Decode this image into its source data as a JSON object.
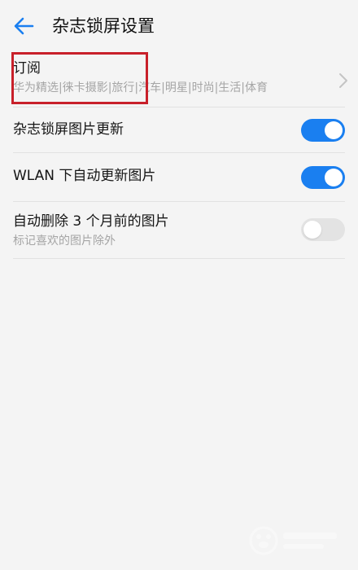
{
  "header": {
    "title": "杂志锁屏设置"
  },
  "items": [
    {
      "title": "订阅",
      "subtitle": "华为精选|徕卡摄影|旅行|汽车|明星|时尚|生活|体育",
      "control": "chevron"
    },
    {
      "title": "杂志锁屏图片更新",
      "control": "toggle",
      "checked": true
    },
    {
      "title": "WLAN 下自动更新图片",
      "control": "toggle",
      "checked": true
    },
    {
      "title": "自动删除 3 个月前的图片",
      "subtitle": "标记喜欢的图片除外",
      "control": "toggle",
      "checked": false
    }
  ],
  "colors": {
    "accent": "#1a7ff0",
    "toggle_off": "#e3e3e3",
    "highlight": "#c8202a",
    "background": "#f4f4f4"
  },
  "icons": {
    "back": "arrow-left-icon",
    "chevron": "chevron-right-icon",
    "watermark": "baidu-jingyan-watermark"
  }
}
